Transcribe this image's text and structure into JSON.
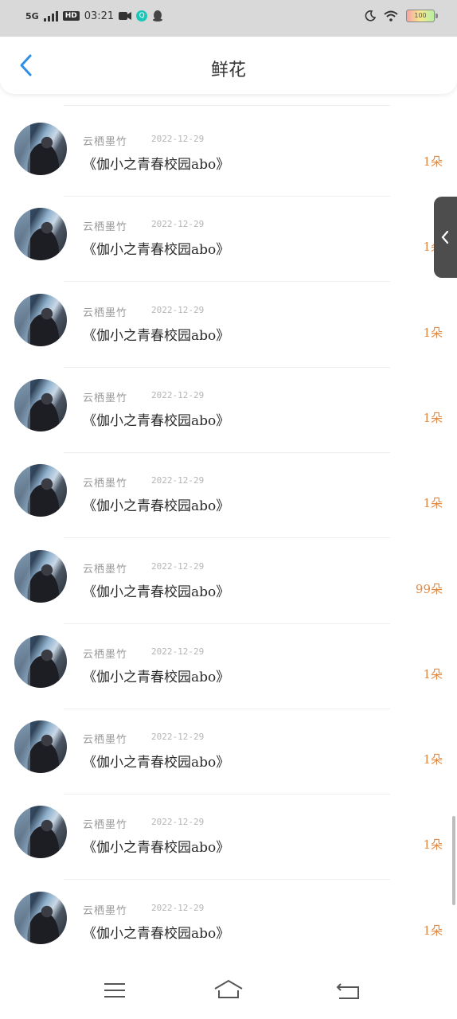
{
  "status_bar": {
    "network": "5G",
    "hd": "HD",
    "time": "03:21",
    "battery": "100"
  },
  "header": {
    "title": "鲜花"
  },
  "records": [
    {
      "name": "云栖墨竹",
      "date": "2022-12-29",
      "book": "《伽小之青春校园abo》",
      "count": "1朵"
    },
    {
      "name": "云栖墨竹",
      "date": "2022-12-29",
      "book": "《伽小之青春校园abo》",
      "count": "1朵"
    },
    {
      "name": "云栖墨竹",
      "date": "2022-12-29",
      "book": "《伽小之青春校园abo》",
      "count": "1朵"
    },
    {
      "name": "云栖墨竹",
      "date": "2022-12-29",
      "book": "《伽小之青春校园abo》",
      "count": "1朵"
    },
    {
      "name": "云栖墨竹",
      "date": "2022-12-29",
      "book": "《伽小之青春校园abo》",
      "count": "1朵"
    },
    {
      "name": "云栖墨竹",
      "date": "2022-12-29",
      "book": "《伽小之青春校园abo》",
      "count": "99朵"
    },
    {
      "name": "云栖墨竹",
      "date": "2022-12-29",
      "book": "《伽小之青春校园abo》",
      "count": "1朵"
    },
    {
      "name": "云栖墨竹",
      "date": "2022-12-29",
      "book": "《伽小之青春校园abo》",
      "count": "1朵"
    },
    {
      "name": "云栖墨竹",
      "date": "2022-12-29",
      "book": "《伽小之青春校园abo》",
      "count": "1朵"
    },
    {
      "name": "云栖墨竹",
      "date": "2022-12-29",
      "book": "《伽小之青春校园abo》",
      "count": "1朵"
    }
  ],
  "colors": {
    "accent": "#2e8ee8",
    "count": "#e08a45",
    "status_bar": "#d9d9d9"
  },
  "icons": {
    "back": "chevron-left-icon",
    "side_tab": "chevron-left-icon",
    "nav": [
      "menu-icon",
      "home-icon",
      "back-arrow-icon"
    ]
  }
}
